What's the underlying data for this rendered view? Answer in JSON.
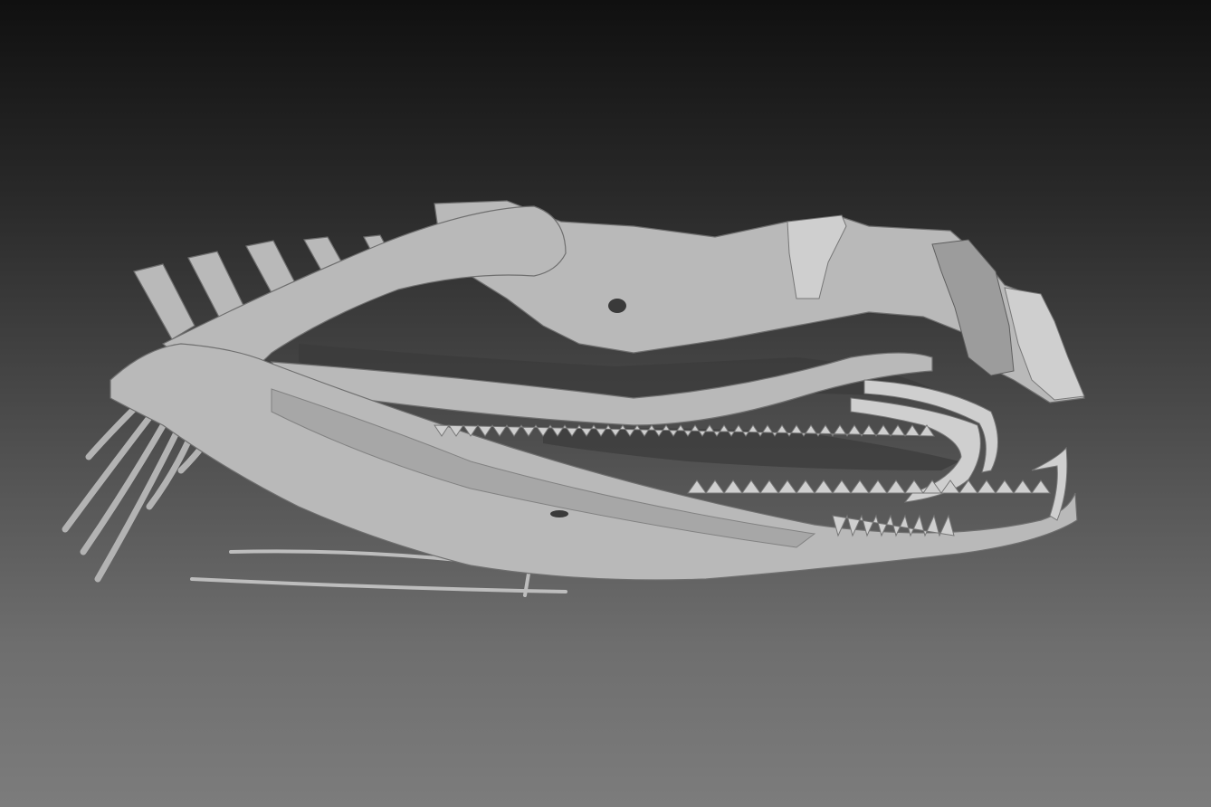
{
  "scene": {
    "subject": "snake-skull-3d-model",
    "colors": {
      "background_top": "#101010",
      "background_bottom": "#7c7c7c",
      "bone": "#b9b9b9",
      "bone_shadow": "#6f6f6f"
    }
  }
}
